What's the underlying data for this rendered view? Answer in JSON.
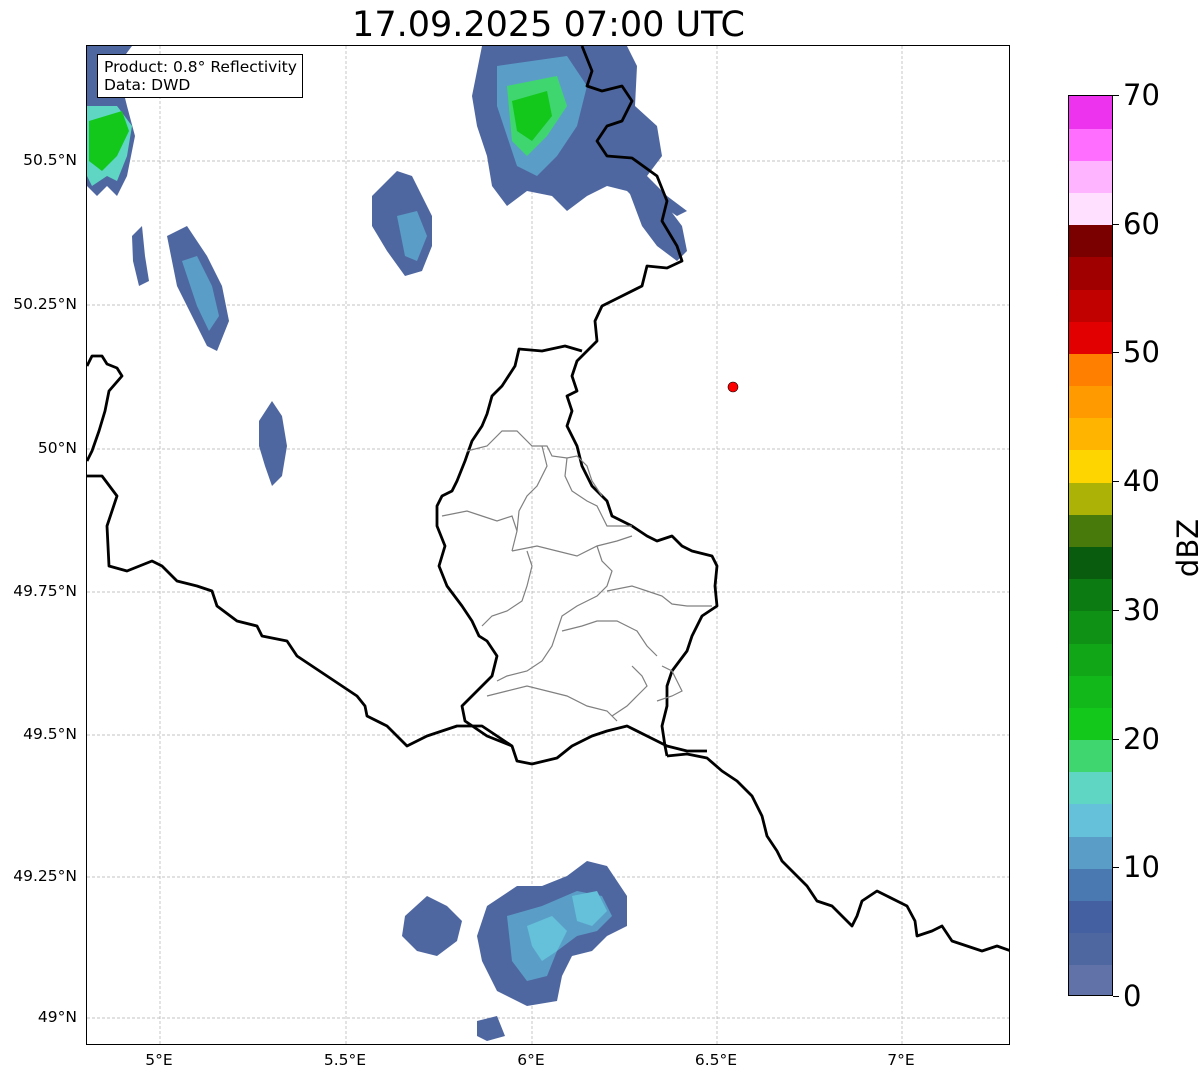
{
  "title": "17.09.2025 07:00 UTC",
  "info_box": {
    "product": "Product: 0.8° Reflectivity",
    "data": "Data: DWD"
  },
  "colors": {
    "border_heavy": "#000000",
    "border_light": "#808080",
    "grid": "#b0b0b0",
    "marker": "#ff0000"
  },
  "map": {
    "lon_labels": [
      "5°E",
      "5.5°E",
      "6°E",
      "6.5°E",
      "7°E"
    ],
    "lat_labels": [
      "50.5°N",
      "50.25°N",
      "50°N",
      "49.75°N",
      "49.5°N",
      "49.25°N",
      "49°N"
    ],
    "marker": {
      "lon": 6.55,
      "lat": 50.11
    }
  },
  "colorbar": {
    "label": "dBZ",
    "tick_labels": [
      "0",
      "10",
      "20",
      "30",
      "40",
      "50",
      "60",
      "70"
    ],
    "min": 0,
    "max": 70,
    "colors": [
      "#6172a8",
      "#4f67a0",
      "#4560a0",
      "#4a78b0",
      "#5a9ec8",
      "#64c1d9",
      "#5fd6c4",
      "#3fd66f",
      "#13c81b",
      "#12b81a",
      "#11a618",
      "#0f9116",
      "#0c7c12",
      "#095c0e",
      "#477a0a",
      "#adb207",
      "#ffd500",
      "#ffb500",
      "#ff9a00",
      "#ff7f00",
      "#e30000",
      "#c10000",
      "#a00000",
      "#7a0000",
      "#ffe0ff",
      "#ffb4ff",
      "#ff6eff",
      "#ee33ee"
    ]
  }
}
